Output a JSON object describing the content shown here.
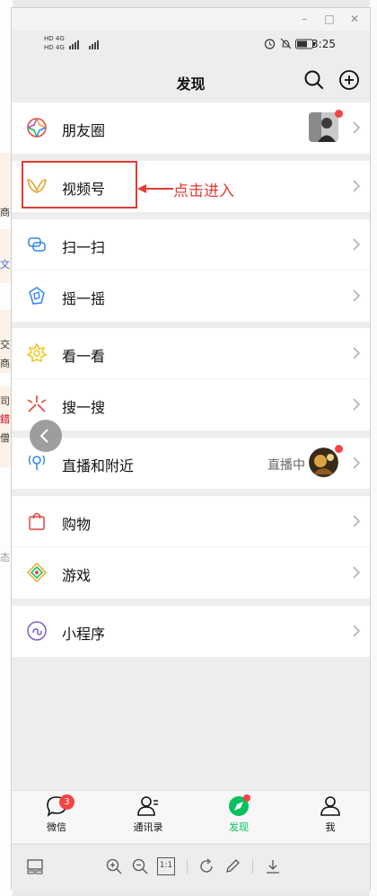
{
  "background": {
    "fragments": [
      "商",
      "文易",
      "交不",
      "商品",
      "司出",
      "錯前",
      "僧",
      "态"
    ]
  },
  "window_controls": {
    "minimize": "–",
    "maximize": "□",
    "close": "✕"
  },
  "statusbar": {
    "sim1": "HD 4G",
    "sim2": "HD 4G",
    "time": "3:25",
    "icons": [
      "alarm-icon",
      "mute-icon",
      "battery-icon"
    ]
  },
  "header": {
    "title": "发现",
    "icons": [
      "search-icon",
      "add-icon"
    ]
  },
  "groups": [
    {
      "items": [
        {
          "label": "朋友圈",
          "icon": "moments-icon",
          "has_thumb": true,
          "has_dot": true
        }
      ]
    },
    {
      "items": [
        {
          "label": "视频号",
          "icon": "channels-icon"
        }
      ]
    },
    {
      "items": [
        {
          "label": "扫一扫",
          "icon": "scan-icon"
        },
        {
          "label": "摇一摇",
          "icon": "shake-icon"
        }
      ]
    },
    {
      "items": [
        {
          "label": "看一看",
          "icon": "top-stories-icon"
        },
        {
          "label": "搜一搜",
          "icon": "search-discover-icon"
        }
      ]
    },
    {
      "items": [
        {
          "label": "直播和附近",
          "icon": "live-nearby-icon",
          "extra": "直播中",
          "has_thumb": true,
          "has_dot": true
        }
      ]
    },
    {
      "items": [
        {
          "label": "购物",
          "icon": "shopping-icon"
        },
        {
          "label": "游戏",
          "icon": "games-icon"
        }
      ]
    },
    {
      "items": [
        {
          "label": "小程序",
          "icon": "mini-programs-icon"
        }
      ]
    }
  ],
  "annotation": {
    "text": "点击进入",
    "color": "#e23b32"
  },
  "tabbar": {
    "tabs": [
      {
        "label": "微信",
        "icon": "chats-icon",
        "badge": "3",
        "active": false
      },
      {
        "label": "通讯录",
        "icon": "contacts-icon",
        "active": false
      },
      {
        "label": "发现",
        "icon": "discover-icon",
        "active": true
      },
      {
        "label": "我",
        "icon": "me-icon",
        "active": false
      }
    ],
    "accent": "#07c160"
  },
  "viewer_toolbar": {
    "icons": [
      "layout-icon",
      "zoom-in-icon",
      "zoom-out-icon",
      "actual-size-icon",
      "rotate-icon",
      "edit-icon",
      "download-icon"
    ],
    "actual_size_label": "1:1"
  }
}
